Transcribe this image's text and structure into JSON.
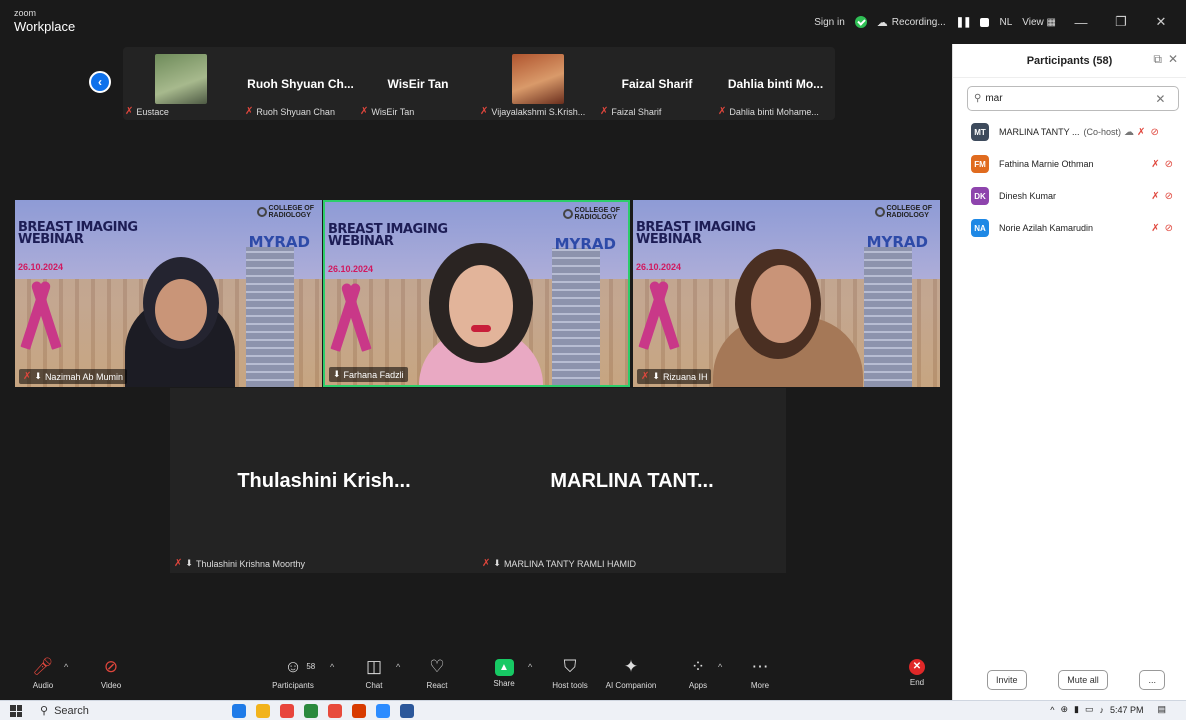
{
  "app": {
    "brand_small": "zoom",
    "brand_main": "Workplace"
  },
  "titlebar": {
    "sign_in": "Sign in",
    "recording": "Recording...",
    "nl": "NL",
    "view": "View"
  },
  "strip": {
    "tiles": [
      {
        "name": "",
        "label": "Eustace"
      },
      {
        "name": "Ruoh Shyuan Ch...",
        "label": "Ruoh Shyuan Chan"
      },
      {
        "name": "WisEir Tan",
        "label": "WisEir Tan"
      },
      {
        "name": "",
        "label": "Vijayalakshmi S.Krish..."
      },
      {
        "name": "Faizal Sharif",
        "label": "Faizal Sharif"
      },
      {
        "name": "Dahlia binti Mo...",
        "label": "Dahlia binti Mohame..."
      }
    ]
  },
  "videos": [
    {
      "label": "Nazimah Ab Mumin"
    },
    {
      "label": "Farhana Fadzli"
    },
    {
      "label": "Rizuana IH"
    }
  ],
  "slide": {
    "title_line1": "BREAST IMAGING",
    "title_line2": "WEBINAR",
    "date": "26.10.2024",
    "logo_line1": "COLLEGE OF",
    "logo_line2": "RADIOLOGY",
    "brand": "MYRAD"
  },
  "tiles": [
    {
      "name": "Thulashini  Krish...",
      "label": "Thulashini Krishna Moorthy"
    },
    {
      "name": "MARLINA  TANT...",
      "label": "MARLINA TANTY RAMLI HAMID"
    }
  ],
  "panel": {
    "title": "Participants (58)",
    "search_value": "mar",
    "participants": [
      {
        "initials": "MT",
        "color": "#3d4a5c",
        "name": "MARLINA TANTY ...",
        "role": "(Co-host)"
      },
      {
        "initials": "FM",
        "color": "#e06b1f",
        "name": "Fathina Marnie Othman",
        "role": ""
      },
      {
        "initials": "DK",
        "color": "#8e44ad",
        "name": "Dinesh Kumar",
        "role": ""
      },
      {
        "initials": "NA",
        "color": "#1e88e5",
        "name": "Norie Azilah Kamarudin",
        "role": ""
      }
    ],
    "invite": "Invite",
    "mute_all": "Mute all",
    "more": "..."
  },
  "toolbar": {
    "audio": "Audio",
    "video": "Video",
    "participants": "Participants",
    "participants_count": "58",
    "chat": "Chat",
    "react": "React",
    "share": "Share",
    "host_tools": "Host tools",
    "ai_companion": "AI Companion",
    "apps": "Apps",
    "more": "More",
    "end": "End"
  },
  "taskbar": {
    "search": "Search",
    "time": "5:47 PM"
  }
}
